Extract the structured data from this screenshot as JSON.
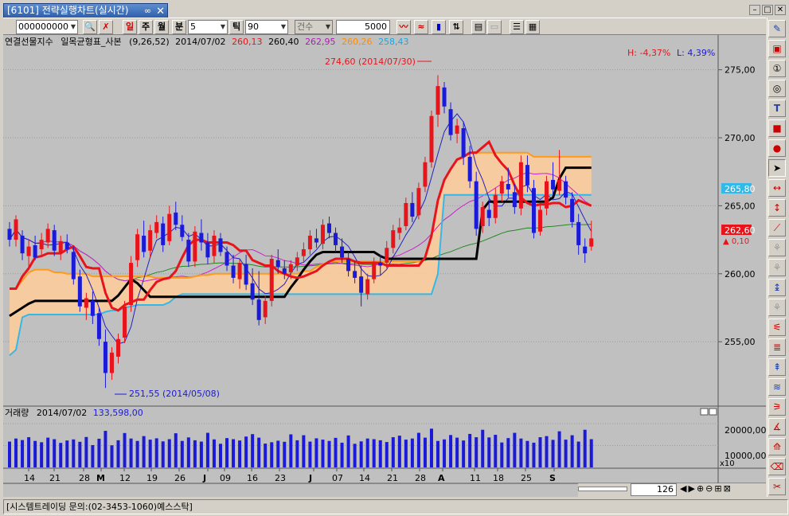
{
  "window": {
    "tab_title": "[6101] 전략실행차트(실시간)",
    "status_text": "[시스템트레이딩 문의:(02-3453-1060)예스스탁]"
  },
  "toolbar": {
    "code_value": "000000000",
    "btn_day": "일",
    "btn_week": "주",
    "btn_month": "월",
    "btn_min": "분",
    "min_value": "5",
    "btn_tick": "틱",
    "tick_value": "90",
    "count_label": "건수",
    "count_value": "5000"
  },
  "legend": {
    "name": "연결선물지수",
    "indicator": "일목균형표_사본",
    "params": "(9,26,52)",
    "date": "2014/07/02",
    "v1": "260,13",
    "v2": "260,40",
    "v3": "262,95",
    "v4": "260,26",
    "v5": "258,43",
    "high_pct": "H: -4,37%",
    "low_pct": "L: 4,39%"
  },
  "annotations": {
    "high": "274,60 (2014/07/30)",
    "low": "251,55 (2014/05/08)"
  },
  "price_axis": {
    "ticks": [
      "275,00",
      "270,00",
      "265,00",
      "260,00",
      "255,00"
    ],
    "last_price": "262,60",
    "last_change": "▲ 0,10",
    "line_price": "265,80"
  },
  "volume": {
    "label": "거래량",
    "date": "2014/07/02",
    "value": "133,598,00",
    "ticks": [
      "20000,00",
      "10000,00"
    ],
    "multiplier": "x10"
  },
  "x_axis": {
    "labels": [
      "14",
      "21",
      "28",
      "M",
      "12",
      "19",
      "26",
      "J",
      "09",
      "16",
      "23",
      "J",
      "07",
      "14",
      "21",
      "28",
      "A",
      "11",
      "18",
      "25",
      "S"
    ]
  },
  "zoom": {
    "value": "126"
  },
  "colors": {
    "up": "#e8141b",
    "down": "#1a1ad8",
    "tenkan": "#e8141b",
    "kijun": "#000000",
    "spanA": "#ff9a1a",
    "spanB": "#33b8e8",
    "cloud": "#ffcc99",
    "ma1": "#2222bb",
    "ma2": "#cc22cc",
    "ma3": "#228822"
  },
  "chart_data": {
    "type": "candlestick",
    "title": "연결선물지수",
    "ylabel": "",
    "ylim": [
      250.5,
      276.5
    ],
    "candles": [
      [
        263.3,
        263.8,
        262.0,
        262.5
      ],
      [
        262.5,
        264.3,
        262.0,
        264.0
      ],
      [
        262.8,
        263.2,
        261.0,
        261.5
      ],
      [
        261.3,
        262.5,
        260.5,
        262.0
      ],
      [
        262.1,
        262.8,
        261.0,
        261.2
      ],
      [
        261.8,
        263.0,
        261.3,
        262.5
      ],
      [
        262.3,
        263.7,
        261.9,
        263.3
      ],
      [
        263.2,
        263.6,
        261.3,
        261.7
      ],
      [
        261.5,
        262.8,
        261.0,
        262.4
      ],
      [
        262.3,
        262.9,
        261.5,
        261.8
      ],
      [
        261.6,
        262.0,
        259.2,
        259.6
      ],
      [
        259.8,
        260.3,
        257.2,
        257.6
      ],
      [
        257.5,
        258.6,
        256.6,
        258.2
      ],
      [
        258.0,
        258.7,
        256.3,
        256.9
      ],
      [
        257.1,
        257.5,
        254.7,
        255.2
      ],
      [
        255.0,
        255.9,
        251.6,
        252.7
      ],
      [
        252.7,
        254.6,
        252.2,
        254.2
      ],
      [
        253.9,
        255.6,
        253.4,
        255.2
      ],
      [
        255.3,
        258.0,
        254.9,
        257.6
      ],
      [
        257.7,
        261.3,
        257.2,
        260.8
      ],
      [
        261.0,
        263.3,
        260.5,
        262.9
      ],
      [
        262.8,
        263.9,
        261.2,
        261.6
      ],
      [
        261.7,
        263.6,
        261.2,
        263.2
      ],
      [
        263.0,
        264.3,
        262.6,
        263.8
      ],
      [
        263.7,
        264.2,
        261.6,
        262.1
      ],
      [
        262.4,
        265.0,
        262.1,
        264.4
      ],
      [
        264.5,
        265.3,
        263.2,
        263.6
      ],
      [
        263.6,
        264.3,
        262.4,
        262.7
      ],
      [
        262.5,
        263.0,
        260.5,
        260.9
      ],
      [
        260.9,
        263.5,
        260.5,
        263.1
      ],
      [
        263.0,
        264.0,
        261.7,
        262.3
      ],
      [
        262.3,
        263.0,
        260.7,
        261.2
      ],
      [
        261.3,
        263.2,
        260.8,
        262.8
      ],
      [
        262.6,
        263.0,
        261.3,
        261.6
      ],
      [
        261.6,
        262.0,
        260.2,
        260.6
      ],
      [
        260.6,
        261.4,
        259.3,
        259.7
      ],
      [
        259.6,
        261.1,
        258.9,
        260.8
      ],
      [
        260.7,
        261.4,
        258.8,
        259.2
      ],
      [
        259.3,
        260.4,
        257.7,
        258.1
      ],
      [
        258.1,
        260.2,
        256.2,
        256.6
      ],
      [
        256.8,
        258.4,
        256.3,
        258.0
      ],
      [
        258.0,
        261.4,
        257.6,
        261.1
      ],
      [
        261.0,
        261.8,
        260.0,
        260.5
      ],
      [
        260.4,
        261.0,
        259.6,
        260.0
      ],
      [
        260.1,
        261.0,
        259.6,
        260.7
      ],
      [
        260.6,
        261.6,
        260.2,
        261.2
      ],
      [
        261.3,
        262.3,
        260.9,
        261.8
      ],
      [
        261.8,
        263.2,
        261.4,
        262.8
      ],
      [
        262.6,
        263.3,
        261.9,
        262.3
      ],
      [
        262.2,
        264.0,
        261.8,
        263.6
      ],
      [
        263.7,
        264.2,
        262.6,
        263.0
      ],
      [
        263.0,
        263.4,
        261.6,
        262.1
      ],
      [
        262.0,
        262.6,
        260.8,
        261.2
      ],
      [
        261.1,
        261.6,
        259.8,
        260.2
      ],
      [
        260.2,
        260.9,
        259.3,
        259.7
      ],
      [
        259.8,
        260.6,
        257.6,
        258.6
      ],
      [
        258.5,
        260.0,
        258.1,
        259.6
      ],
      [
        259.6,
        261.2,
        259.3,
        260.9
      ],
      [
        260.8,
        261.4,
        259.9,
        260.6
      ],
      [
        260.8,
        262.4,
        260.4,
        261.9
      ],
      [
        261.9,
        263.6,
        261.5,
        263.2
      ],
      [
        263.0,
        264.1,
        262.5,
        263.4
      ],
      [
        263.5,
        265.6,
        263.2,
        265.2
      ],
      [
        265.2,
        266.0,
        263.8,
        264.2
      ],
      [
        264.3,
        266.7,
        264.0,
        266.3
      ],
      [
        266.4,
        268.6,
        266.0,
        268.2
      ],
      [
        268.2,
        272.0,
        267.8,
        271.6
      ],
      [
        271.7,
        274.6,
        270.8,
        273.8
      ],
      [
        273.7,
        274.1,
        271.8,
        272.3
      ],
      [
        272.1,
        272.6,
        269.8,
        270.2
      ],
      [
        270.3,
        271.4,
        269.6,
        270.9
      ],
      [
        270.7,
        271.2,
        268.0,
        268.6
      ],
      [
        268.6,
        269.4,
        266.3,
        266.8
      ],
      [
        266.8,
        267.5,
        262.8,
        263.3
      ],
      [
        263.5,
        265.3,
        263.0,
        264.9
      ],
      [
        264.7,
        265.6,
        263.5,
        264.1
      ],
      [
        264.1,
        266.3,
        263.7,
        265.8
      ],
      [
        265.9,
        267.2,
        265.3,
        266.8
      ],
      [
        266.6,
        267.8,
        265.6,
        266.2
      ],
      [
        266.0,
        266.6,
        264.4,
        264.9
      ],
      [
        264.8,
        268.7,
        264.3,
        268.2
      ],
      [
        268.0,
        268.7,
        266.0,
        266.5
      ],
      [
        266.3,
        266.9,
        262.6,
        263.0
      ],
      [
        263.1,
        265.2,
        262.8,
        264.7
      ],
      [
        264.8,
        267.2,
        264.3,
        266.8
      ],
      [
        266.9,
        268.2,
        265.8,
        266.2
      ],
      [
        266.1,
        269.1,
        265.8,
        266.9
      ],
      [
        266.8,
        267.2,
        265.1,
        265.6
      ],
      [
        265.5,
        266.0,
        263.4,
        263.8
      ],
      [
        263.8,
        264.4,
        261.4,
        262.1
      ],
      [
        262.0,
        262.6,
        260.8,
        261.5
      ],
      [
        262.0,
        263.9,
        261.7,
        262.6
      ]
    ],
    "volume": [
      11800,
      13200,
      12500,
      13800,
      12100,
      11500,
      13600,
      12900,
      11200,
      12300,
      12800,
      11700,
      13900,
      10200,
      13100,
      16700,
      10100,
      12400,
      15700,
      13200,
      12100,
      14300,
      12700,
      13300,
      11900,
      12900,
      15600,
      12100,
      13700,
      12400,
      11800,
      15800,
      12800,
      10800,
      13400,
      12900,
      12300,
      14100,
      15200,
      13600,
      10900,
      11500,
      12200,
      11700,
      15100,
      12400,
      14700,
      11800,
      13300,
      12700,
      12100,
      13500,
      11300,
      14600,
      10800,
      11900,
      13200,
      12900,
      12400,
      11600,
      13800,
      14500,
      12700,
      13200,
      15800,
      13600,
      17700,
      12100,
      12800,
      14800,
      13600,
      12300,
      15300,
      13800,
      17200,
      13700,
      14900,
      11400,
      13400,
      15800,
      13200,
      12100,
      11300,
      13800,
      14300,
      12600,
      16500,
      12700,
      14700,
      11800,
      17200,
      12900
    ],
    "tenkan": [
      258.9,
      258.9,
      259.8,
      260.4,
      261.2,
      261.3,
      261.5,
      261.5,
      261.5,
      261.8,
      262.0,
      261.3,
      260.5,
      260.4,
      260.4,
      258.6,
      257.5,
      257.3,
      257.7,
      257.9,
      258.1,
      258.1,
      258.8,
      259.4,
      259.6,
      259.7,
      260.2,
      261.2,
      262.1,
      262.5,
      262.5,
      262.3,
      262.3,
      262.3,
      262.3,
      262.1,
      261.7,
      261.7,
      261.0,
      260.8,
      260.6,
      260.6,
      260.2,
      260.0,
      259.8,
      259.7,
      259.8,
      260.0,
      260.2,
      260.6,
      260.9,
      261.1,
      261.1,
      261.1,
      260.9,
      260.8,
      260.8,
      260.8,
      260.8,
      260.6,
      260.6,
      260.6,
      260.6,
      260.6,
      260.6,
      261.2,
      262.8,
      265.4,
      266.9,
      267.7,
      268.4,
      268.6,
      268.9,
      268.9,
      269.3,
      269.7,
      268.7,
      268.1,
      267.6,
      266.5,
      265.6,
      265.2,
      265.0,
      265.1,
      265.1,
      265.2,
      265.2,
      264.9,
      265.0,
      265.4,
      265.2,
      265.0
    ],
    "kijun": [
      256.9,
      257.2,
      257.5,
      257.8,
      258.0,
      258.0,
      258.0,
      258.0,
      258.0,
      258.0,
      258.0,
      258.0,
      258.0,
      258.0,
      258.0,
      258.0,
      258.0,
      258.4,
      259.0,
      259.6,
      259.3,
      258.8,
      258.3,
      258.3,
      258.3,
      258.3,
      258.3,
      258.3,
      258.3,
      258.3,
      258.3,
      258.3,
      258.3,
      258.3,
      258.3,
      258.3,
      258.3,
      258.3,
      258.3,
      258.3,
      258.3,
      258.3,
      258.3,
      258.3,
      259.0,
      259.6,
      260.3,
      260.9,
      261.4,
      261.6,
      261.6,
      261.6,
      261.6,
      261.6,
      261.6,
      261.6,
      261.6,
      261.6,
      261.3,
      261.1,
      261.1,
      261.1,
      261.1,
      261.1,
      261.1,
      261.1,
      261.1,
      261.1,
      261.1,
      261.1,
      261.1,
      261.1,
      261.1,
      261.1,
      264.7,
      265.3,
      265.3,
      265.3,
      265.3,
      265.3,
      265.3,
      265.3,
      265.3,
      265.3,
      265.3,
      265.6,
      267.0,
      267.8,
      267.8,
      267.8,
      267.8,
      267.8
    ],
    "spanA": [
      258.9,
      258.9,
      259.5,
      260.1,
      260.3,
      260.3,
      260.3,
      260.1,
      260.1,
      260.0,
      260.0,
      260.0,
      260.0,
      259.8,
      259.8,
      259.8,
      259.8,
      259.8,
      259.8,
      259.8,
      259.8,
      259.8,
      259.8,
      259.7,
      259.7,
      259.7,
      259.7,
      259.7,
      259.7,
      259.8,
      259.9,
      259.9,
      260.0,
      260.0,
      260.0,
      260.0,
      260.0,
      260.0,
      260.0,
      260.0,
      260.0,
      260.0,
      260.0,
      260.0,
      260.0,
      260.0,
      260.2,
      260.2,
      260.5,
      260.7,
      260.9,
      260.9,
      260.9,
      260.9,
      260.9,
      260.9,
      260.9,
      260.9,
      260.9,
      260.9,
      260.9,
      260.9,
      260.9,
      260.9,
      260.9,
      261.2,
      262.8,
      265.4,
      266.9,
      267.7,
      268.4,
      268.6,
      268.9,
      268.9,
      268.9,
      268.9,
      268.9,
      268.9,
      268.9,
      268.9,
      268.9,
      268.9,
      268.6,
      268.6,
      268.6,
      268.6,
      268.6,
      268.6,
      268.6,
      268.6,
      268.6,
      268.6
    ],
    "spanB": [
      254.0,
      254.4,
      256.8,
      257.0,
      257.0,
      257.0,
      257.0,
      257.0,
      257.0,
      257.0,
      257.0,
      257.0,
      257.0,
      257.0,
      257.0,
      257.2,
      257.3,
      257.3,
      257.5,
      257.6,
      257.7,
      257.7,
      257.7,
      257.7,
      257.7,
      257.9,
      258.3,
      258.5,
      258.5,
      258.5,
      258.5,
      258.5,
      258.5,
      258.5,
      258.5,
      258.5,
      258.5,
      258.5,
      258.5,
      258.5,
      258.5,
      258.5,
      258.5,
      258.5,
      258.5,
      258.5,
      258.5,
      258.5,
      258.5,
      258.5,
      258.5,
      258.5,
      258.5,
      258.5,
      258.5,
      258.5,
      258.5,
      258.5,
      258.5,
      258.5,
      258.5,
      258.5,
      258.5,
      258.5,
      258.5,
      258.5,
      258.5,
      260.0,
      265.8,
      265.8,
      265.8,
      265.8,
      265.8,
      265.8,
      265.8,
      265.8,
      265.8,
      265.8,
      265.8,
      265.8,
      265.8,
      265.8,
      265.8,
      265.8,
      265.8,
      265.8,
      265.8,
      265.8,
      265.8,
      265.8,
      265.8,
      265.8
    ]
  }
}
